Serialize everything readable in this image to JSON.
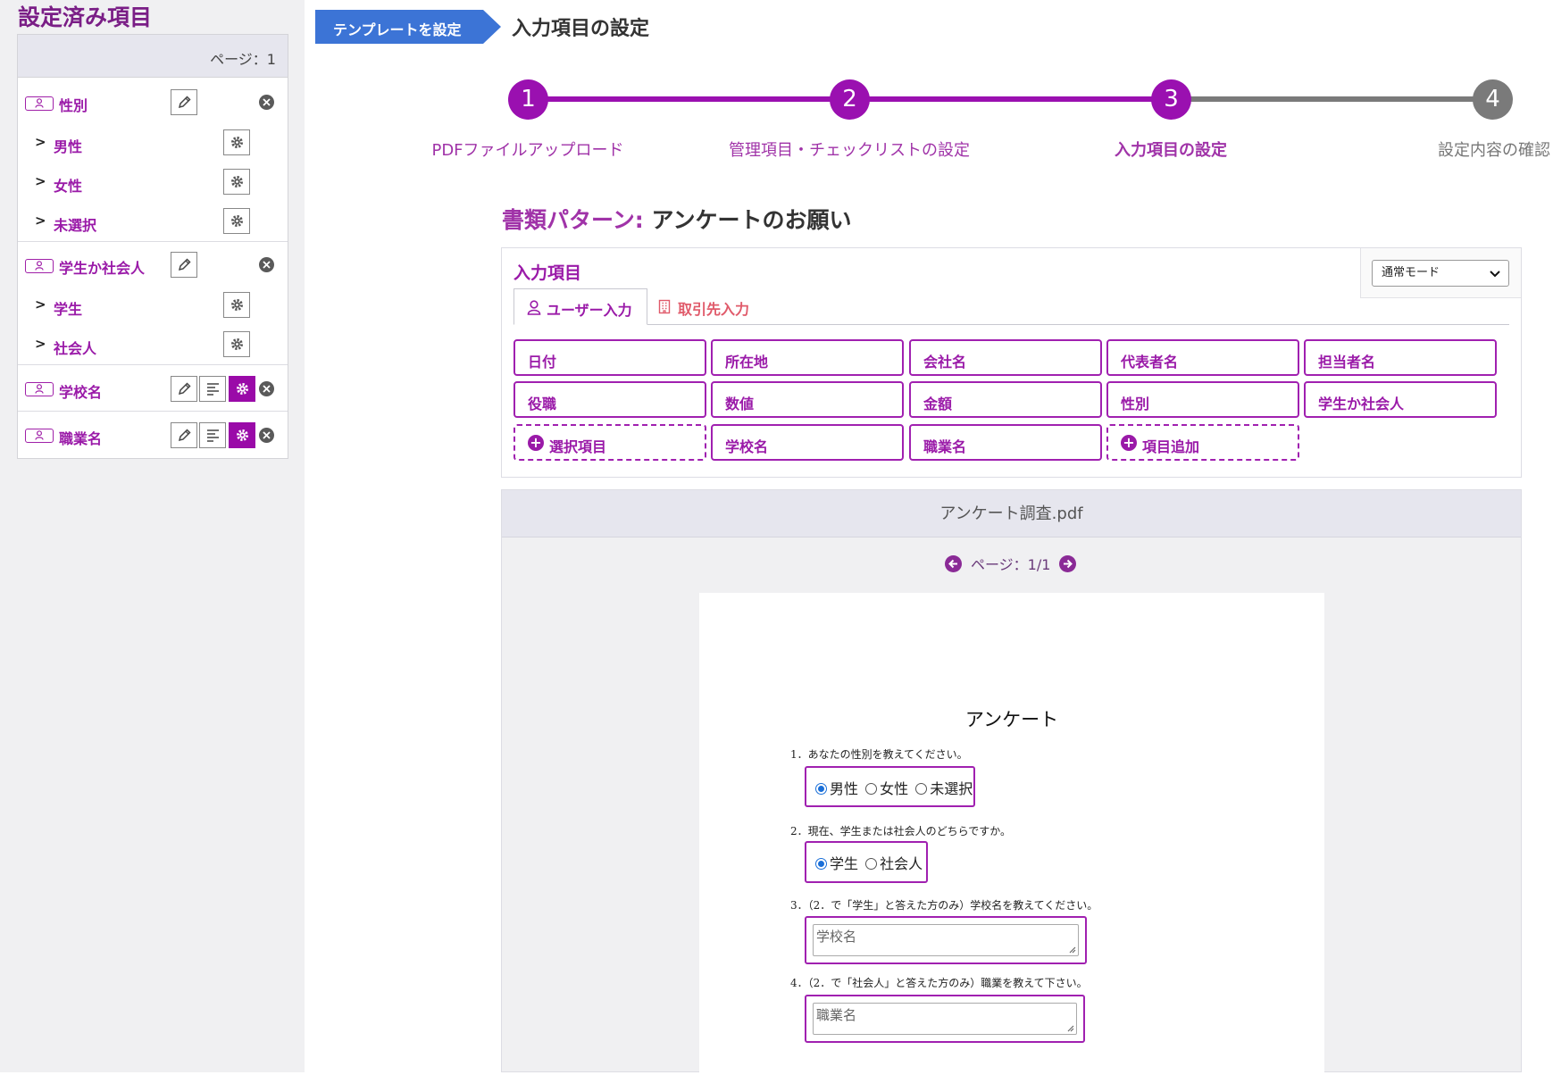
{
  "sidebar": {
    "title": "設定済み項目",
    "page_label": "ページ：1",
    "groups": [
      {
        "label": "性別",
        "options": [
          "男性",
          "女性",
          "未選択"
        ]
      },
      {
        "label": "学生か社会人",
        "options": [
          "学生",
          "社会人"
        ]
      },
      {
        "label": "学校名"
      },
      {
        "label": "職業名"
      }
    ]
  },
  "breadcrumb": {
    "label": "テンプレートを設定"
  },
  "page_title": "入力項目の設定",
  "stepper": {
    "steps": [
      {
        "number": "1",
        "label": "PDFファイルアップロード",
        "state": "done"
      },
      {
        "number": "2",
        "label": "管理項目・チェックリストの設定",
        "state": "done"
      },
      {
        "number": "3",
        "label": "入力項目の設定",
        "state": "current"
      },
      {
        "number": "4",
        "label": "設定内容の確認",
        "state": "pending"
      }
    ]
  },
  "doc_pattern": {
    "key": "書類パターン:",
    "value": "アンケートのお願い"
  },
  "input_items": {
    "title": "入力項目",
    "mode_select": "通常モード",
    "tabs": [
      {
        "label": "ユーザー入力",
        "icon": "person-icon"
      },
      {
        "label": "取引先入力",
        "icon": "building-icon"
      }
    ],
    "buttons": [
      {
        "label": "日付"
      },
      {
        "label": "所在地"
      },
      {
        "label": "会社名"
      },
      {
        "label": "代表者名"
      },
      {
        "label": "担当者名"
      },
      {
        "label": "役職"
      },
      {
        "label": "数値"
      },
      {
        "label": "金額"
      },
      {
        "label": "性別"
      },
      {
        "label": "学生か社会人"
      },
      {
        "label": "選択項目",
        "add": true
      },
      {
        "label": "学校名"
      },
      {
        "label": "職業名"
      },
      {
        "label": "項目追加",
        "add": true
      }
    ]
  },
  "viewer": {
    "filename": "アンケート調査.pdf",
    "pager": "ページ：1/1",
    "pdf": {
      "title": "アンケート",
      "q1": "1．あなたの性別を教えてください。",
      "q1_options": [
        "男性",
        "女性",
        "未選択"
      ],
      "q2": "2．現在、学生または社会人のどちらですか。",
      "q2_options": [
        "学生",
        "社会人"
      ],
      "q3": "3．（2．で「学生」と答えた方のみ）学校名を教えてください。",
      "q3_placeholder": "学校名",
      "q4": "4．（2．で「社会人」と答えた方のみ）職業を教えて下さい。",
      "q4_placeholder": "職業名"
    }
  },
  "colors": {
    "accent": "#9a1aa8",
    "breadcrumb": "#3c74d6",
    "pending_step": "#777777",
    "partner_tab": "#e05a6a"
  }
}
